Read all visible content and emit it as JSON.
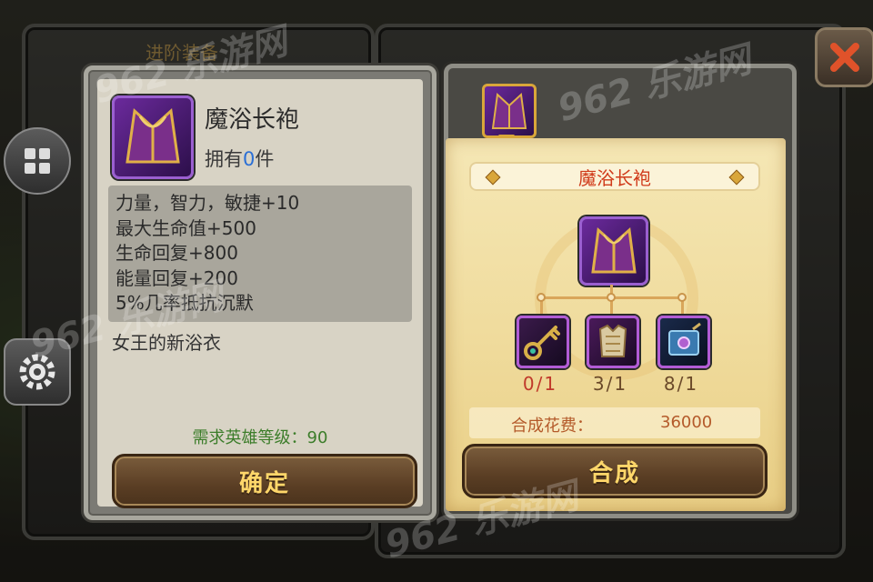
{
  "background": {
    "panel_title": "进阶装备"
  },
  "item_detail": {
    "icon": "robe-icon",
    "name": "魔浴长袍",
    "own_prefix": "拥有",
    "own_count": "0",
    "own_suffix": "件",
    "stats": [
      "力量，智力，敏捷+10",
      "最大生命值+500",
      "生命回复+800",
      "能量回复+200",
      "5%几率抵抗沉默"
    ],
    "description": "女王的新浴衣",
    "requirement": "需求英雄等级：90",
    "confirm_label": "确定"
  },
  "crafting": {
    "title": "魔浴长袍",
    "result_icon": "robe-icon",
    "materials": [
      {
        "icon": "key-icon",
        "count": "0/1",
        "color": "#c0392b"
      },
      {
        "icon": "armor-icon",
        "count": "3/1",
        "color": "#6b4a2a"
      },
      {
        "icon": "spellbook-icon",
        "count": "8/1",
        "color": "#6b4a2a"
      }
    ],
    "cost_label": "合成花费：",
    "cost_value": "36000",
    "craft_label": "合成"
  },
  "watermark": "962 乐游网",
  "colors": {
    "accent_gold": "#ffd76a",
    "title_red": "#d03a1a",
    "requirement_green": "#3c7d2a",
    "own_count_blue": "#2a6fd6"
  }
}
